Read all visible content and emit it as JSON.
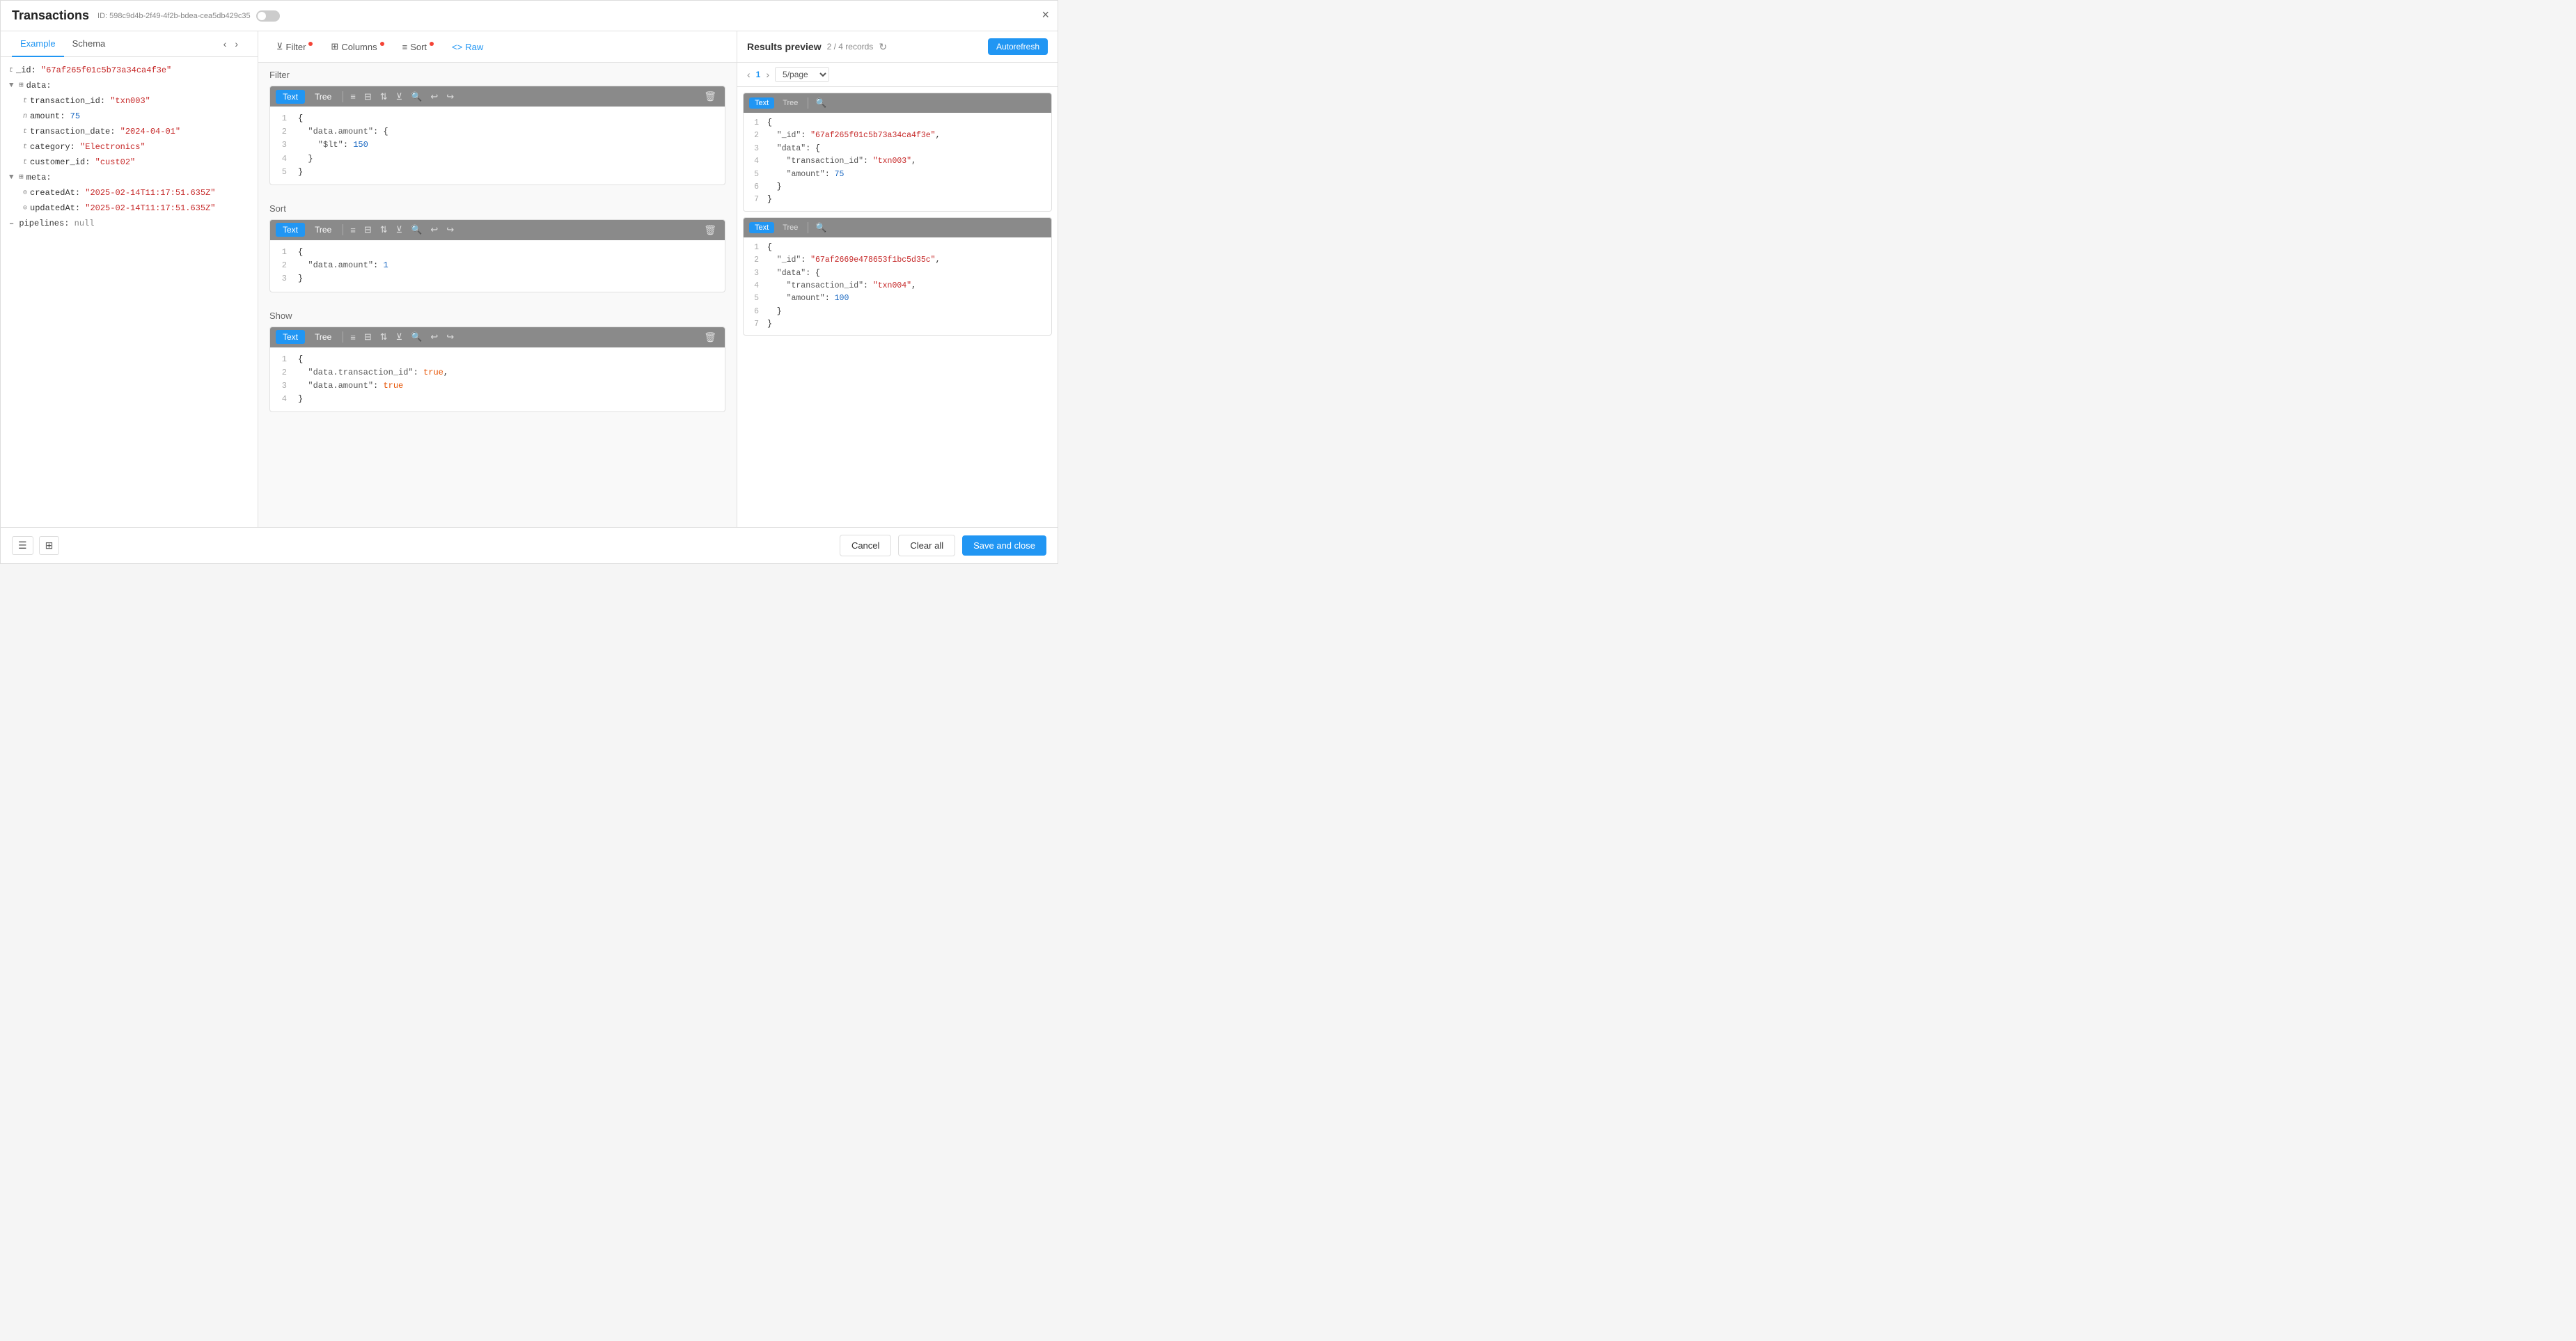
{
  "modal": {
    "title": "Transactions",
    "id_label": "ID: 598c9d4b-2f49-4f2b-bdea-cea5db429c35",
    "close_icon": "×"
  },
  "tabs": {
    "example_label": "Example",
    "schema_label": "Schema"
  },
  "left_panel": {
    "nav_prev": "‹",
    "nav_next": "›",
    "tree": [
      {
        "indent": 0,
        "type": "t",
        "key": "_id:",
        "value": "\"67af265f01c5b73a34ca4f3e\"",
        "value_type": "string"
      },
      {
        "indent": 0,
        "expand": "▼",
        "type": "",
        "key": "data:",
        "value": "",
        "value_type": ""
      },
      {
        "indent": 1,
        "type": "t",
        "key": "transaction_id:",
        "value": "\"txn003\"",
        "value_type": "string"
      },
      {
        "indent": 1,
        "type": "n",
        "key": "amount:",
        "value": "75",
        "value_type": "number"
      },
      {
        "indent": 1,
        "type": "t",
        "key": "transaction_date:",
        "value": "\"2024-04-01\"",
        "value_type": "string"
      },
      {
        "indent": 1,
        "type": "t",
        "key": "category:",
        "value": "\"Electronics\"",
        "value_type": "string"
      },
      {
        "indent": 1,
        "type": "t",
        "key": "customer_id:",
        "value": "\"cust02\"",
        "value_type": "string"
      },
      {
        "indent": 0,
        "expand": "▼",
        "type": "",
        "key": "meta:",
        "value": "",
        "value_type": ""
      },
      {
        "indent": 1,
        "type": "⊙",
        "key": "createdAt:",
        "value": "\"2025-02-14T11:17:51.635Z\"",
        "value_type": "string"
      },
      {
        "indent": 1,
        "type": "⊙",
        "key": "updatedAt:",
        "value": "\"2025-02-14T11:17:51.635Z\"",
        "value_type": "string"
      },
      {
        "indent": 0,
        "type": "",
        "key": "pipelines:",
        "value": "null",
        "value_type": "null"
      }
    ]
  },
  "middle_panel": {
    "tabs": [
      {
        "label": "Filter",
        "icon": "⊻",
        "dot": true
      },
      {
        "label": "Columns",
        "icon": "⊞",
        "dot": true
      },
      {
        "label": "Sort",
        "icon": "≡",
        "dot": true
      },
      {
        "label": "Raw",
        "icon": "<>",
        "active": true,
        "dot": false
      }
    ],
    "sections": [
      {
        "label": "Filter",
        "code_tabs": [
          "Text",
          "Tree"
        ],
        "active_tab": "Text",
        "lines": [
          "{",
          "  \"data.amount\": {",
          "    \"$lt\": 150",
          "  }",
          "}"
        ],
        "line_numbers": [
          "1",
          "2",
          "3",
          "4",
          "5"
        ]
      },
      {
        "label": "Sort",
        "code_tabs": [
          "Text",
          "Tree"
        ],
        "active_tab": "Text",
        "lines": [
          "{",
          "  \"data.amount\": 1",
          "}"
        ],
        "line_numbers": [
          "1",
          "2",
          "3"
        ]
      },
      {
        "label": "Show",
        "code_tabs": [
          "Text",
          "Tree"
        ],
        "active_tab": "Text",
        "lines": [
          "{",
          "  \"data.transaction_id\": true,",
          "  \"data.amount\": true",
          "}"
        ],
        "line_numbers": [
          "1",
          "2",
          "3",
          "4"
        ]
      }
    ]
  },
  "right_panel": {
    "title": "Results preview",
    "records": "2 / 4 records",
    "autorefresh_label": "Autorefresh",
    "page": "1",
    "per_page": "5/page",
    "results": [
      {
        "lines": [
          "{",
          "  \"_id\": \"67af265f01c5b73a34ca4f3e\",",
          "  \"data\": {",
          "    \"transaction_id\": \"txn003\",",
          "    \"amount\": 75",
          "  }",
          "}"
        ],
        "line_numbers": [
          "1",
          "2",
          "3",
          "4",
          "5",
          "6",
          "7"
        ]
      },
      {
        "lines": [
          "{",
          "  \"_id\": \"67af2669e478653f1bc5d35c\",",
          "  \"data\": {",
          "    \"transaction_id\": \"txn004\",",
          "    \"amount\": 100",
          "  }",
          "}"
        ],
        "line_numbers": [
          "1",
          "2",
          "3",
          "4",
          "5",
          "6",
          "7"
        ]
      }
    ]
  },
  "footer": {
    "cancel_label": "Cancel",
    "clear_label": "Clear all",
    "save_label": "Save and close"
  }
}
